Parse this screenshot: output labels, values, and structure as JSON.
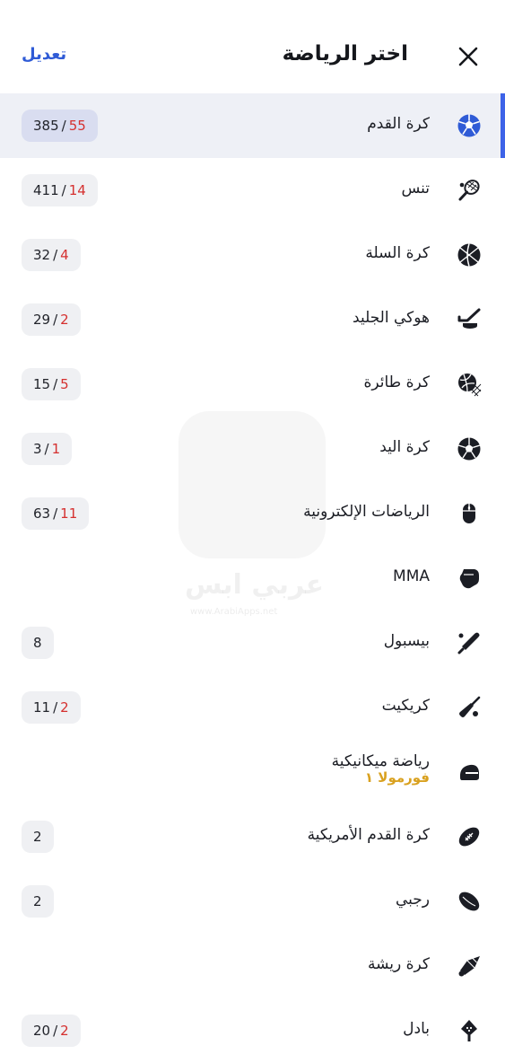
{
  "header": {
    "title": "اختر الرياضة",
    "edit_label": "تعديل"
  },
  "colors": {
    "accent": "#3d63e8",
    "live_count": "#d5302f",
    "subtitle": "#d9a11f",
    "active_row_bg": "#eef0f6"
  },
  "watermark": {
    "text": "عربي ابس",
    "url": "www.ArabiApps.net"
  },
  "sports": [
    {
      "label": "كرة القدم",
      "icon": "soccer-ball-icon",
      "live": "55",
      "total": "385",
      "active": true
    },
    {
      "label": "تنس",
      "icon": "tennis-racket-icon",
      "live": "14",
      "total": "411"
    },
    {
      "label": "كرة السلة",
      "icon": "basketball-icon",
      "live": "4",
      "total": "32"
    },
    {
      "label": "هوكي الجليد",
      "icon": "ice-hockey-icon",
      "live": "2",
      "total": "29"
    },
    {
      "label": "كرة طائرة",
      "icon": "volleyball-icon",
      "live": "5",
      "total": "15"
    },
    {
      "label": "كرة اليد",
      "icon": "handball-icon",
      "live": "1",
      "total": "3"
    },
    {
      "label": "الرياضات الإلكترونية",
      "icon": "mouse-icon",
      "live": "11",
      "total": "63"
    },
    {
      "label": "MMA",
      "icon": "mma-glove-icon"
    },
    {
      "label": "بيسبول",
      "icon": "baseball-bat-icon",
      "total": "8"
    },
    {
      "label": "كريكيت",
      "icon": "cricket-bat-icon",
      "live": "2",
      "total": "11"
    },
    {
      "label": "رياضة ميكانيكية",
      "subtitle": "فورمولا ١",
      "icon": "racing-helmet-icon"
    },
    {
      "label": "كرة القدم الأمريكية",
      "icon": "american-football-icon",
      "total": "2"
    },
    {
      "label": "رجبي",
      "icon": "rugby-ball-icon",
      "total": "2"
    },
    {
      "label": "كرة ريشة",
      "icon": "shuttlecock-icon"
    },
    {
      "label": "بادل",
      "icon": "padel-icon",
      "live": "2",
      "total": "20"
    }
  ]
}
